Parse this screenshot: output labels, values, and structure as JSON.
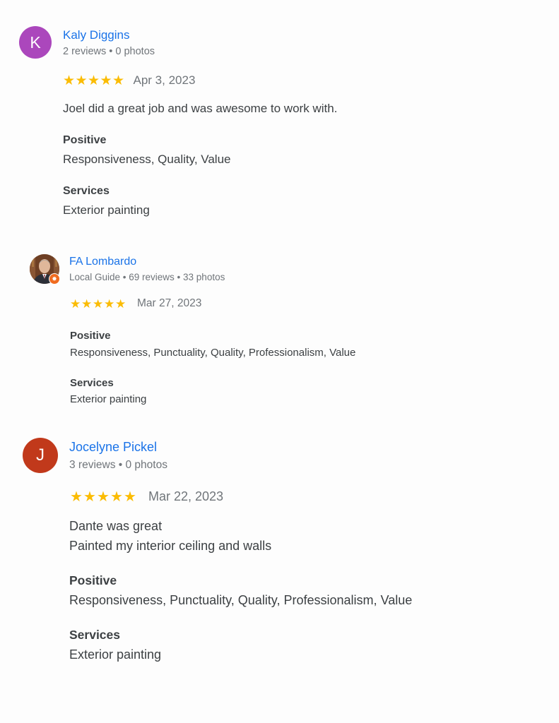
{
  "reviews": [
    {
      "avatar_letter": "K",
      "avatar_color": "#ab47bc",
      "author": "Kaly Diggins",
      "meta": "2 reviews • 0 photos",
      "rating": 5,
      "date": "Apr 3, 2023",
      "text_lines": [
        "Joel did a great job and was awesome to work with."
      ],
      "positive_heading": "Positive",
      "positive": "Responsiveness, Quality, Value",
      "services_heading": "Services",
      "services": "Exterior painting"
    },
    {
      "avatar_type": "photo",
      "badge": "local-guide-badge-icon",
      "author": "FA Lombardo",
      "meta": "Local Guide • 69 reviews • 33 photos",
      "rating": 5,
      "date": "Mar 27, 2023",
      "text_lines": [],
      "positive_heading": "Positive",
      "positive": "Responsiveness, Punctuality, Quality, Professionalism, Value",
      "services_heading": "Services",
      "services": "Exterior painting"
    },
    {
      "avatar_letter": "J",
      "avatar_color": "#c1391b",
      "author": "Jocelyne Pickel",
      "meta": "3 reviews • 0 photos",
      "rating": 5,
      "date": "Mar 22, 2023",
      "text_lines": [
        "Dante was great",
        "Painted my interior ceiling and walls"
      ],
      "positive_heading": "Positive",
      "positive": "Responsiveness, Punctuality, Quality, Professionalism, Value",
      "services_heading": "Services",
      "services": "Exterior painting"
    }
  ],
  "colors": {
    "link": "#1a73e8",
    "star": "#fbbc04",
    "meta": "#70757a",
    "text": "#3c4043",
    "badge": "#f06b1f"
  },
  "icons": {
    "star": "star-icon",
    "badge": "local-guide-badge-icon"
  }
}
